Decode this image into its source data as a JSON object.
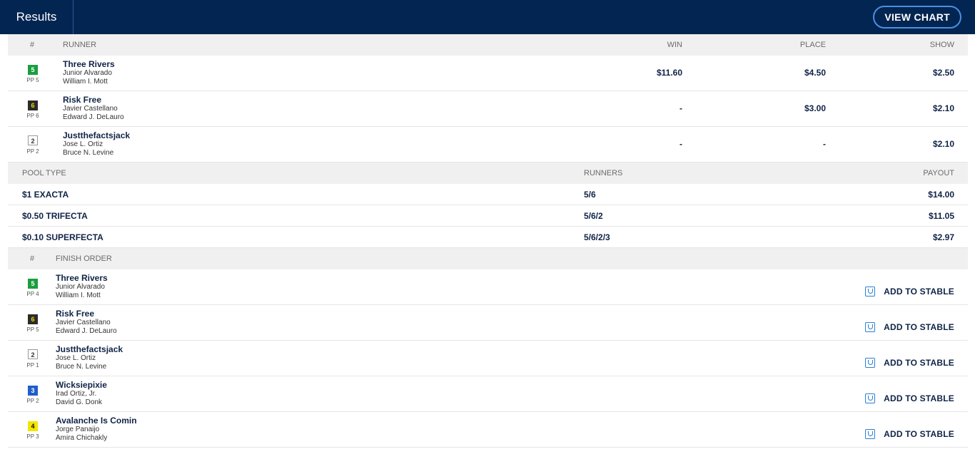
{
  "header": {
    "title": "Results",
    "view_chart_label": "VIEW CHART"
  },
  "results_table": {
    "columns": {
      "num": "#",
      "runner": "RUNNER",
      "win": "WIN",
      "place": "PLACE",
      "show": "SHOW"
    },
    "rows": [
      {
        "program": "5",
        "pp": "PP 5",
        "name": "Three Rivers",
        "jockey": "Junior Alvarado",
        "trainer": "William I. Mott",
        "win": "$11.60",
        "place": "$4.50",
        "show": "$2.50",
        "badge_bg": "#1a9e3f",
        "badge_fg": "#ffffff"
      },
      {
        "program": "6",
        "pp": "PP 6",
        "name": "Risk Free",
        "jockey": "Javier Castellano",
        "trainer": "Edward J. DeLauro",
        "win": "-",
        "place": "$3.00",
        "show": "$2.10",
        "badge_bg": "#2b2b2b",
        "badge_fg": "#f2d500"
      },
      {
        "program": "2",
        "pp": "PP 2",
        "name": "Justthefactsjack",
        "jockey": "Jose L. Ortiz",
        "trainer": "Bruce N. Levine",
        "win": "-",
        "place": "-",
        "show": "$2.10",
        "badge_bg": "#ffffff",
        "badge_fg": "#333333"
      }
    ]
  },
  "pool_table": {
    "columns": {
      "pool_type": "POOL TYPE",
      "runners": "RUNNERS",
      "payout": "PAYOUT"
    },
    "rows": [
      {
        "pool_type": "$1 EXACTA",
        "runners": "5/6",
        "payout": "$14.00"
      },
      {
        "pool_type": "$0.50 TRIFECTA",
        "runners": "5/6/2",
        "payout": "$11.05"
      },
      {
        "pool_type": "$0.10 SUPERFECTA",
        "runners": "5/6/2/3",
        "payout": "$2.97"
      }
    ]
  },
  "finish_table": {
    "columns": {
      "num": "#",
      "finish_order": "FINISH ORDER"
    },
    "add_label": "ADD TO STABLE",
    "rows": [
      {
        "program": "5",
        "pp": "PP 4",
        "name": "Three Rivers",
        "jockey": "Junior Alvarado",
        "trainer": "William I. Mott",
        "badge_bg": "#1a9e3f",
        "badge_fg": "#ffffff"
      },
      {
        "program": "6",
        "pp": "PP 5",
        "name": "Risk Free",
        "jockey": "Javier Castellano",
        "trainer": "Edward J. DeLauro",
        "badge_bg": "#2b2b2b",
        "badge_fg": "#f2d500"
      },
      {
        "program": "2",
        "pp": "PP 1",
        "name": "Justthefactsjack",
        "jockey": "Jose L. Ortiz",
        "trainer": "Bruce N. Levine",
        "badge_bg": "#ffffff",
        "badge_fg": "#333333"
      },
      {
        "program": "3",
        "pp": "PP 2",
        "name": "Wicksiepixie",
        "jockey": "Irad Ortiz, Jr.",
        "trainer": "David G. Donk",
        "badge_bg": "#1f5fc9",
        "badge_fg": "#ffffff"
      },
      {
        "program": "4",
        "pp": "PP 3",
        "name": "Avalanche Is Comin",
        "jockey": "Jorge Panaijo",
        "trainer": "Amira Chichakly",
        "badge_bg": "#f2e600",
        "badge_fg": "#111111"
      }
    ]
  }
}
